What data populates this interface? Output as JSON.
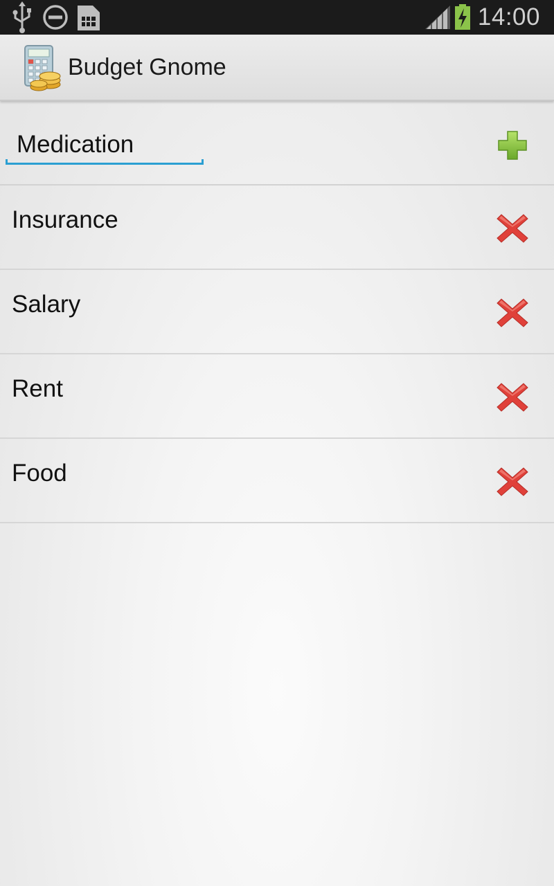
{
  "status_bar": {
    "time": "14:00",
    "icons": [
      "usb-icon",
      "do-not-disturb-icon",
      "sim-card-icon",
      "signal-icon",
      "battery-charging-icon"
    ]
  },
  "action_bar": {
    "app_icon": "calculator-coins-icon",
    "title": "Budget Gnome"
  },
  "add_row": {
    "input_value": "Medication",
    "add_icon": "plus-icon",
    "colors": {
      "input_accent": "#2b9fd2",
      "add": "#8cc63f"
    }
  },
  "items": [
    {
      "label": "Insurance",
      "delete_icon": "delete-x-icon"
    },
    {
      "label": "Salary",
      "delete_icon": "delete-x-icon"
    },
    {
      "label": "Rent",
      "delete_icon": "delete-x-icon"
    },
    {
      "label": "Food",
      "delete_icon": "delete-x-icon"
    }
  ],
  "colors": {
    "delete": "#e0413a",
    "battery": "#8bc34a"
  }
}
